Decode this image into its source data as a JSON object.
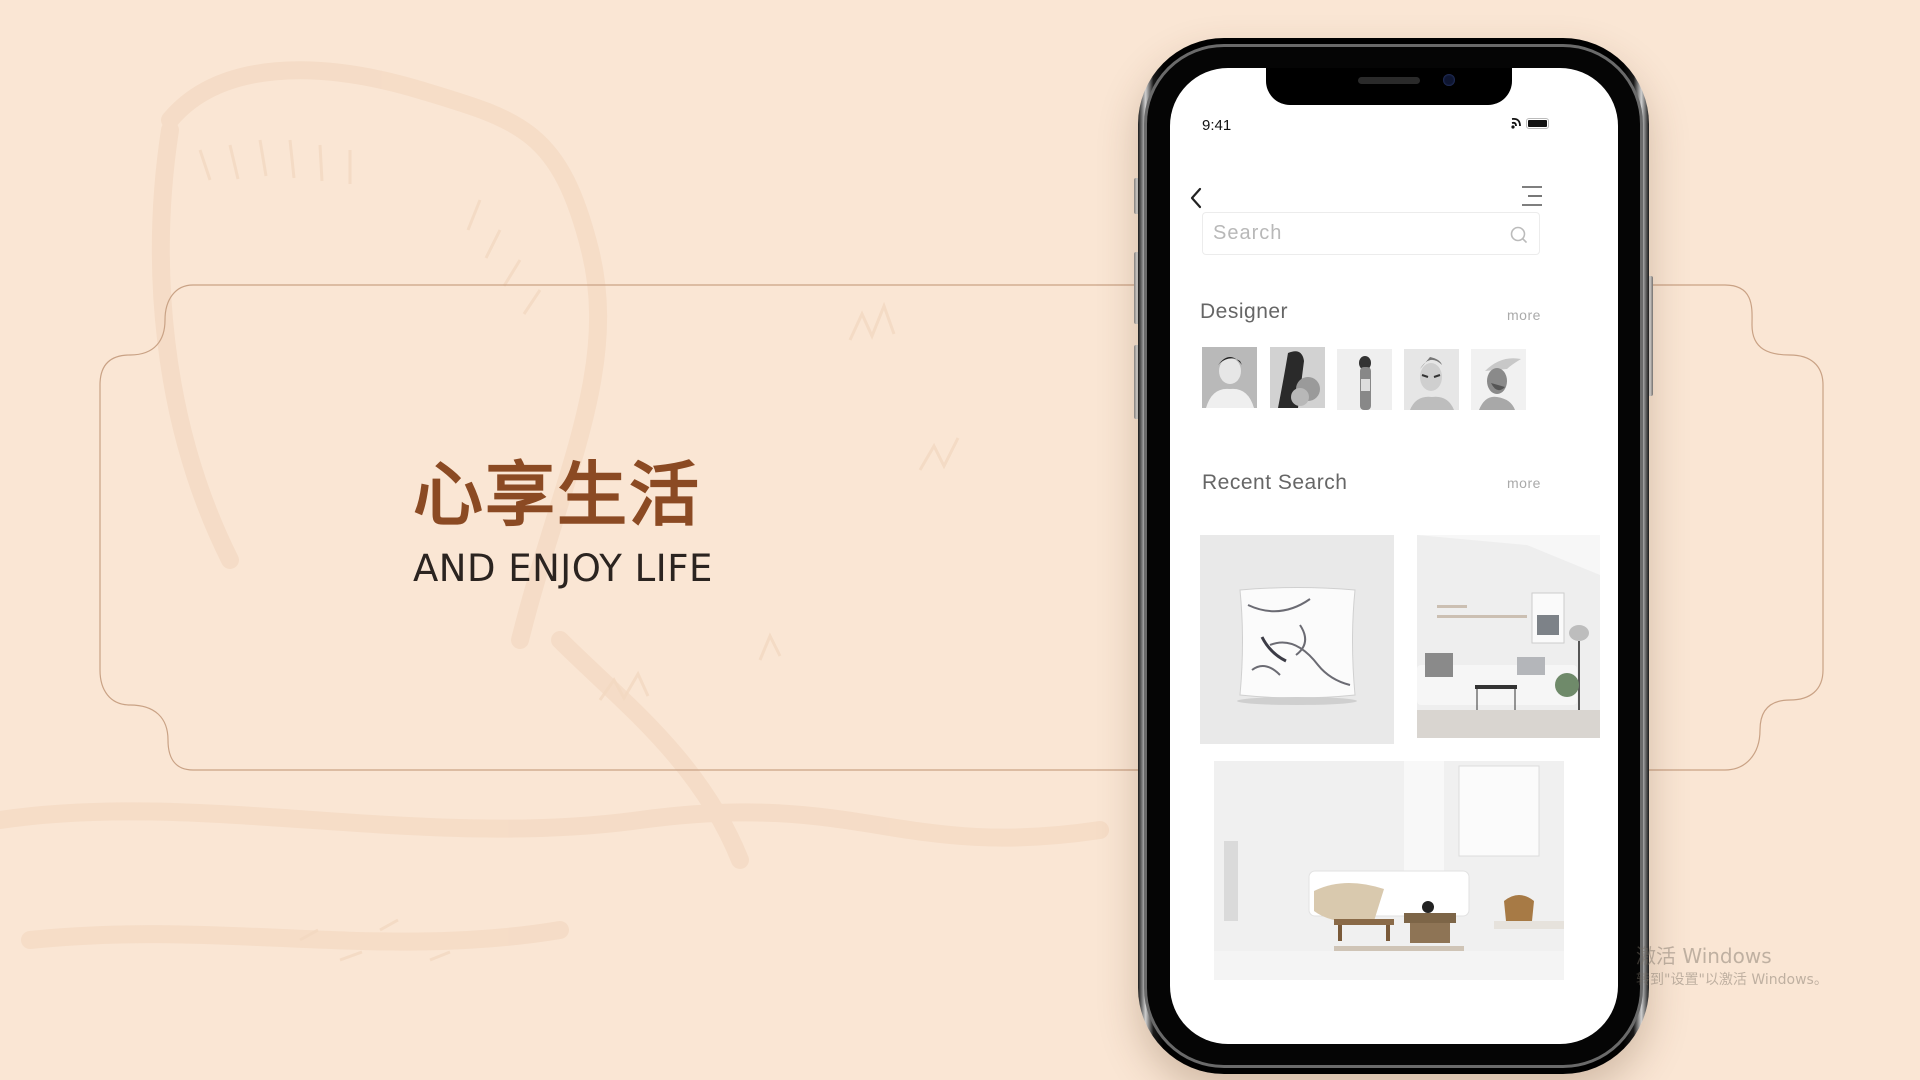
{
  "slide": {
    "title_cn": "心享生活",
    "title_en": "AND ENJOY LIFE",
    "accent_color": "#8b4a23",
    "background_color": "#fae6d4"
  },
  "phone": {
    "status_bar": {
      "time": "9:41",
      "icons": [
        "wifi-icon",
        "battery-icon"
      ]
    },
    "nav": {
      "back_icon": "chevron-left-icon",
      "menu_icon": "menu-icon"
    },
    "search": {
      "placeholder": "Search",
      "value": "",
      "icon": "search-icon"
    },
    "designer_section": {
      "title": "Designer",
      "more_label": "more",
      "avatars": [
        {
          "alt": "designer-1"
        },
        {
          "alt": "designer-2"
        },
        {
          "alt": "designer-3"
        },
        {
          "alt": "designer-4"
        },
        {
          "alt": "designer-5"
        }
      ]
    },
    "recent_section": {
      "title": "Recent Search",
      "more_label": "more",
      "items": [
        {
          "alt": "marble-pillow"
        },
        {
          "alt": "living-room-sofa"
        },
        {
          "alt": "white-living-room"
        }
      ]
    }
  },
  "watermark": {
    "line1": "激活 Windows",
    "line2": "转到\"设置\"以激活 Windows。"
  }
}
